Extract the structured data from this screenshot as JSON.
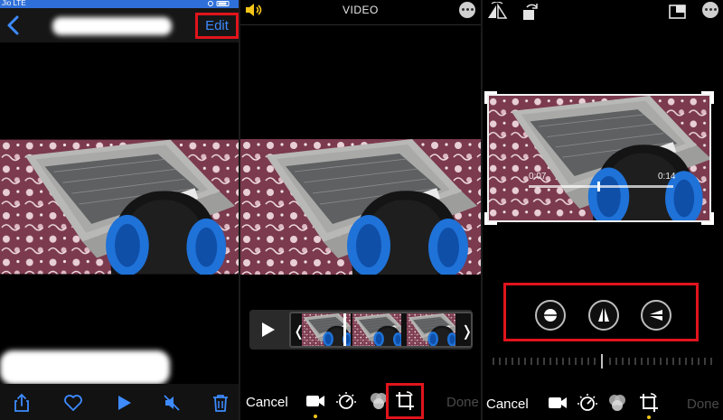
{
  "left_screen": {
    "status": {
      "carrier": "Jio LTE"
    },
    "nav": {
      "edit_label": "Edit"
    },
    "toolbar": {
      "share_icon": "share-icon",
      "favorite_icon": "heart-icon",
      "play_icon": "play-icon",
      "mute_icon": "speaker-muted-icon",
      "delete_icon": "trash-icon"
    }
  },
  "middle_screen": {
    "title": "VIDEO",
    "cancel_label": "Cancel",
    "done_label": "Done",
    "tools": [
      "video-camera-icon",
      "adjust-dial-icon",
      "filters-icon",
      "crop-rotate-icon"
    ]
  },
  "right_screen": {
    "time_start": "0:07",
    "time_end": "0:14",
    "cancel_label": "Cancel",
    "done_label": "Done",
    "crop_tools": [
      "straighten-icon",
      "vertical-perspective-icon",
      "horizontal-perspective-icon"
    ],
    "top_tools": [
      "flip-icon",
      "rotate-icon",
      "aspect-ratio-icon",
      "more-icon"
    ]
  },
  "colors": {
    "highlight_red": "#e1141c",
    "ios_blue": "#3d8bff",
    "active_yellow": "#f5c518",
    "fabric_maroon": "#7b3a4e"
  }
}
